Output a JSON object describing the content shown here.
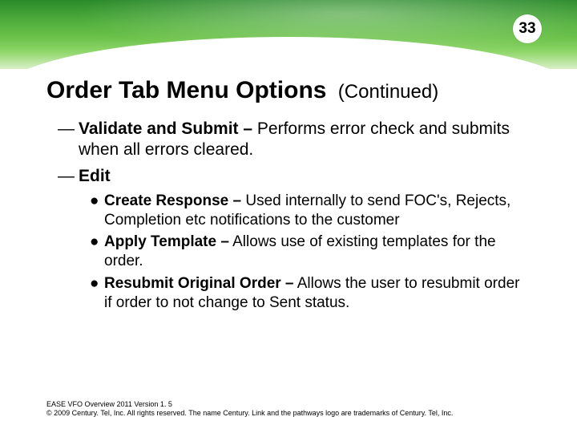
{
  "page_number": "33",
  "title_main": "Order Tab Menu Options",
  "title_cont": "(Continued)",
  "items": [
    {
      "label": "Validate and Submit –",
      "text": " Performs error check and submits when all errors cleared."
    },
    {
      "label": "Edit",
      "text": ""
    }
  ],
  "subitems": [
    {
      "label": "Create Response –",
      "text": " Used internally to send FOC's, Rejects, Completion etc notifications to the customer"
    },
    {
      "label": "Apply Template –",
      "text": " Allows use of existing templates for the order."
    },
    {
      "label": "Resubmit Original Order –",
      "text": " Allows the user to resubmit order if order to not change to Sent status."
    }
  ],
  "footer": {
    "line1": "EASE VFO Overview 2011 Version 1. 5",
    "line2": "© 2009 Century. Tel, Inc. All rights reserved. The name Century. Link and the pathways logo are trademarks of Century. Tel, Inc."
  }
}
